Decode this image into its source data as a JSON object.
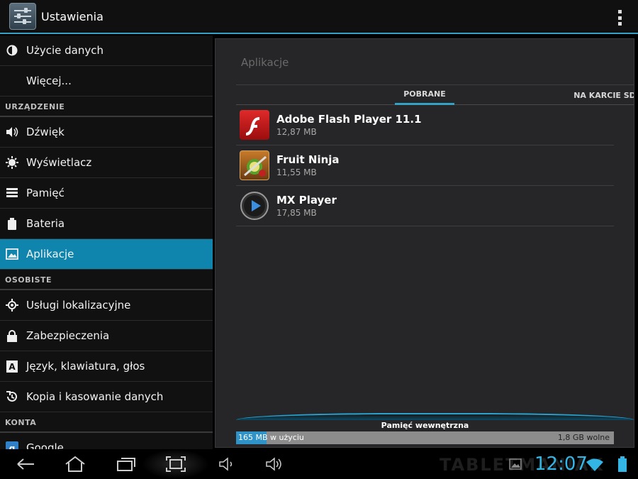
{
  "actionbar": {
    "title": "Ustawienia"
  },
  "sidebar": {
    "items": [
      {
        "type": "item",
        "label": "Użycie danych",
        "icon": "data-usage-icon"
      },
      {
        "type": "item",
        "label": "Więcej...",
        "icon": ""
      },
      {
        "type": "header",
        "label": "URZĄDZENIE"
      },
      {
        "type": "item",
        "label": "Dźwięk",
        "icon": "sound-icon"
      },
      {
        "type": "item",
        "label": "Wyświetlacz",
        "icon": "display-icon"
      },
      {
        "type": "item",
        "label": "Pamięć",
        "icon": "storage-icon"
      },
      {
        "type": "item",
        "label": "Bateria",
        "icon": "battery-icon"
      },
      {
        "type": "item",
        "label": "Aplikacje",
        "icon": "apps-icon",
        "active": true
      },
      {
        "type": "header",
        "label": "OSOBISTE"
      },
      {
        "type": "item",
        "label": "Usługi lokalizacyjne",
        "icon": "location-icon"
      },
      {
        "type": "item",
        "label": "Zabezpieczenia",
        "icon": "lock-icon"
      },
      {
        "type": "item",
        "label": "Język, klawiatura, głos",
        "icon": "language-icon"
      },
      {
        "type": "item",
        "label": "Kopia i kasowanie danych",
        "icon": "backup-icon"
      },
      {
        "type": "header",
        "label": "KONTA"
      },
      {
        "type": "item",
        "label": "Google",
        "icon": "google-icon"
      }
    ]
  },
  "main": {
    "title": "Aplikacje",
    "tabs": [
      {
        "label": "POBRANE",
        "selected": true
      },
      {
        "label": "NA KARCIE SD",
        "selected": false
      }
    ],
    "apps": [
      {
        "name": "Adobe Flash Player 11.1",
        "size": "12,87 MB",
        "icon": "flash-player-icon"
      },
      {
        "name": "Fruit Ninja",
        "size": "11,55 MB",
        "icon": "fruit-ninja-icon"
      },
      {
        "name": "MX Player",
        "size": "17,85 MB",
        "icon": "mx-player-icon"
      }
    ],
    "storage": {
      "label": "Pamięć wewnętrzna",
      "used_text": "165 MB w użyciu",
      "free_text": "1,8 GB wolne",
      "used_fraction": 0.08
    }
  },
  "systembar": {
    "clock": "12:07",
    "watermark": "TABLETMANIAK"
  },
  "colors": {
    "accent": "#33a2c6",
    "active_item": "#0f85ae"
  }
}
